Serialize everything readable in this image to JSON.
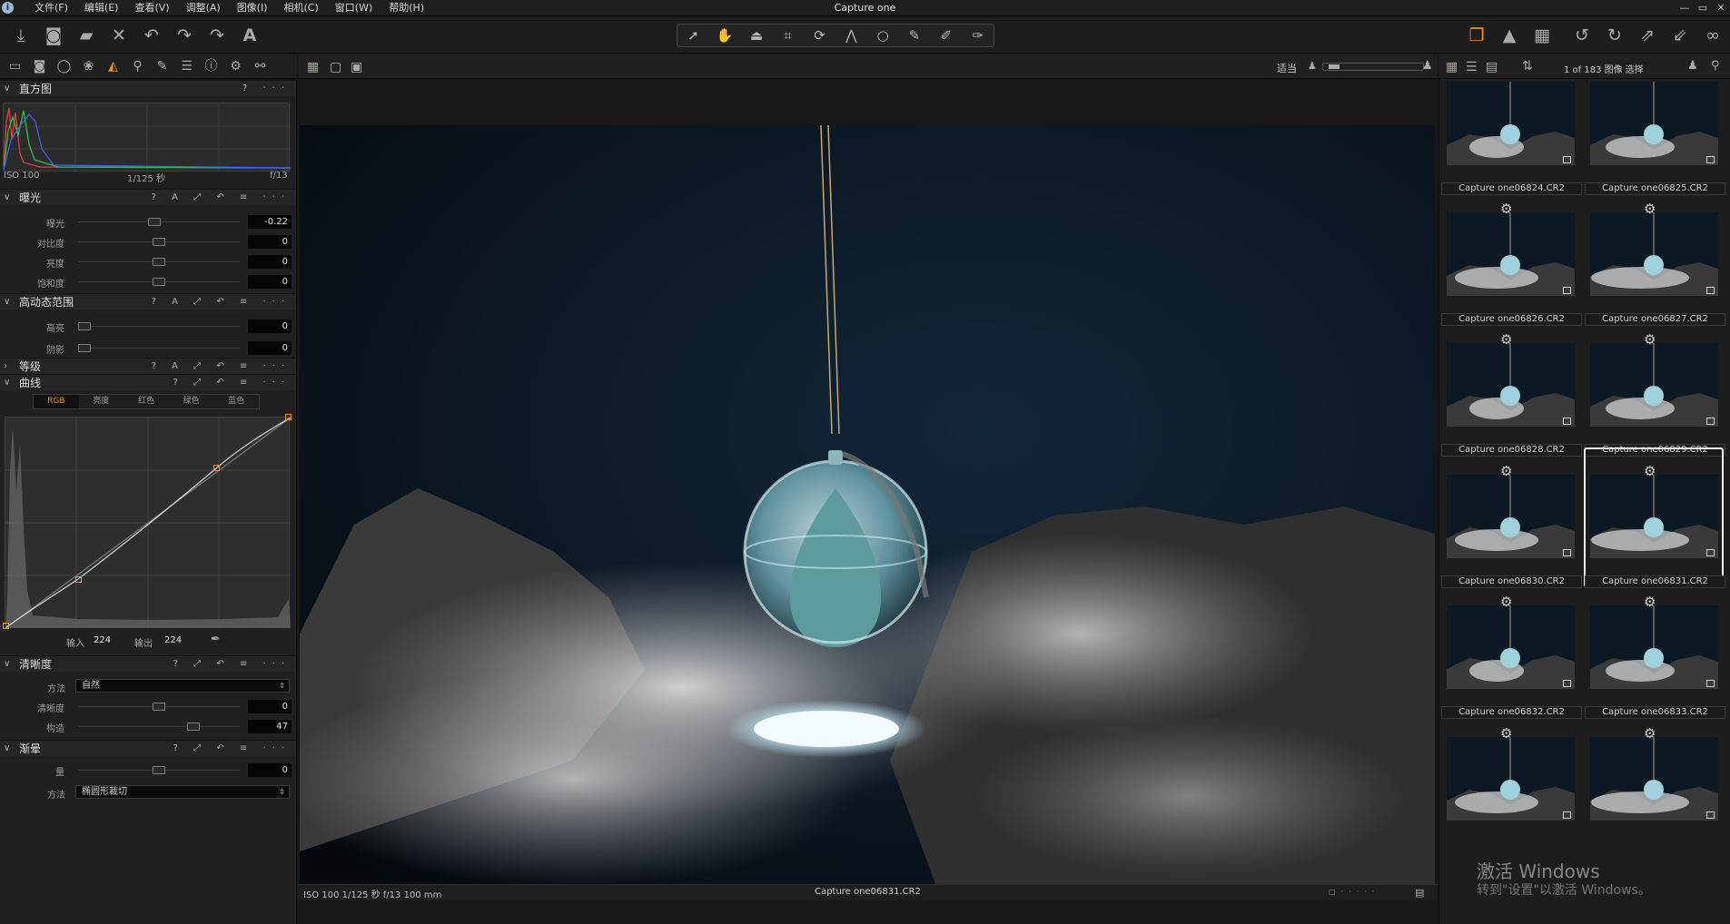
{
  "app": {
    "title": "Capture one",
    "logo_letter": "i"
  },
  "menu": [
    "文件(F)",
    "编辑(E)",
    "查看(V)",
    "调整(A)",
    "图像(I)",
    "相机(C)",
    "窗口(W)",
    "帮助(H)"
  ],
  "window_controls": [
    "—",
    "▭",
    "✕"
  ],
  "toolbar": {
    "left_icons": [
      "import-icon",
      "camera-icon",
      "folder-icon",
      "delete-icon",
      "undo-icon",
      "redo-icon",
      "text-tool-icon"
    ],
    "cursor_tools": [
      "select-cursor-icon",
      "hand-pan-icon",
      "keystone-icon",
      "crop-icon",
      "rotate-icon",
      "straighten-icon",
      "circle-mask-icon",
      "brush-icon",
      "eraser-icon",
      "picker-brush-icon"
    ],
    "active_cursor_tool": "hand-pan-icon",
    "right_icons": [
      "workspace-icon",
      "warning-icon",
      "grid-icon",
      "rotate-left-icon",
      "rotate-right-icon",
      "expand-icon",
      "compare-icon",
      "glasses-icon"
    ],
    "accent_color": "#f29318"
  },
  "tool_tabs": [
    "library-icon",
    "capture-icon",
    "lens-icon",
    "color-icon",
    "exposure-icon",
    "details-icon",
    "local-adjust-icon",
    "metadata-icon",
    "info-icon",
    "settings-icon",
    "batch-icon"
  ],
  "histogram": {
    "title": "直方图",
    "iso": "ISO 100",
    "shutter": "1/125 秒",
    "aperture": "f/13",
    "icons": "? ···"
  },
  "exposure": {
    "title": "曝光",
    "icons": "? A ⤢ ↶ ≡ ···",
    "sliders": [
      {
        "label": "曝光",
        "value": "-0.22",
        "pos": 0.47
      },
      {
        "label": "对比度",
        "value": "0",
        "pos": 0.5
      },
      {
        "label": "亮度",
        "value": "0",
        "pos": 0.5
      },
      {
        "label": "饱和度",
        "value": "0",
        "pos": 0.5
      }
    ]
  },
  "hdr": {
    "title": "高动态范围",
    "icons": "? A ⤢ ↶ ≡ ···",
    "sliders": [
      {
        "label": "高亮",
        "value": "0",
        "pos": 0
      },
      {
        "label": "阴影",
        "value": "0",
        "pos": 0
      }
    ]
  },
  "levels": {
    "title": "等级",
    "icons": "? A ⤢ ↶ ≡ ···"
  },
  "curves": {
    "title": "曲线",
    "icons": "? ⤢ ↶ ≡ ···",
    "tabs": [
      "RGB",
      "亮度",
      "红色",
      "绿色",
      "蓝色"
    ],
    "active_tab": "RGB",
    "input_label": "输入",
    "input_value": "224",
    "output_label": "输出",
    "output_value": "224"
  },
  "clarity": {
    "title": "清晰度",
    "icons": "? ⤢ ↶ ≡ ···",
    "method_label": "方法",
    "method_value": "自然",
    "sliders": [
      {
        "label": "清晰度",
        "value": "0",
        "pos": 0.5
      },
      {
        "label": "构造",
        "value": "47",
        "pos": 0.73
      }
    ]
  },
  "vignetting": {
    "title": "渐晕",
    "icons": "? ⤢ ↶ ≡ ···",
    "sliders": [
      {
        "label": "量",
        "value": "0",
        "pos": 0.5
      }
    ],
    "method_label": "方法",
    "method_value": "椭圆形裁切"
  },
  "viewer": {
    "fit_label": "适当",
    "status_meta": "ISO 100  1/125 秒  f/13  100 mm",
    "status_file": "Capture one06831.CR2"
  },
  "browser": {
    "count_label": "1 of 183 图像 选择",
    "thumbnails": [
      {
        "name": "Capture one06824.CR2",
        "gear": false,
        "selected": false
      },
      {
        "name": "Capture one06825.CR2",
        "gear": false,
        "selected": false
      },
      {
        "name": "Capture one06826.CR2",
        "gear": true,
        "selected": false
      },
      {
        "name": "Capture one06827.CR2",
        "gear": true,
        "selected": false
      },
      {
        "name": "Capture one06828.CR2",
        "gear": true,
        "selected": false
      },
      {
        "name": "Capture one06829.CR2",
        "gear": true,
        "selected": false
      },
      {
        "name": "Capture one06830.CR2",
        "gear": true,
        "selected": false
      },
      {
        "name": "Capture one06831.CR2",
        "gear": true,
        "selected": true
      },
      {
        "name": "Capture one06832.CR2",
        "gear": true,
        "selected": false
      },
      {
        "name": "Capture one06833.CR2",
        "gear": true,
        "selected": false
      },
      {
        "name": "",
        "gear": true,
        "selected": false
      },
      {
        "name": "",
        "gear": true,
        "selected": false
      }
    ]
  },
  "watermark": {
    "line1": "激活 Windows",
    "line2": "转到\"设置\"以激活 Windows。"
  }
}
